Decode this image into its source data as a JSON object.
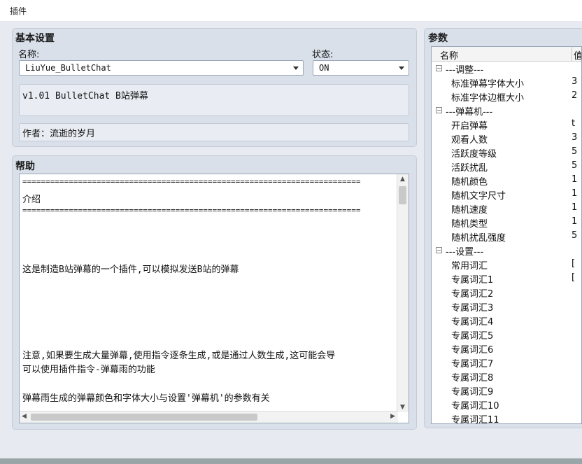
{
  "window": {
    "title": "插件"
  },
  "basic": {
    "title": "基本设置",
    "name_label": "名称:",
    "name_value": "LiuYue_BulletChat",
    "status_label": "状态:",
    "status_value": "ON",
    "description": "v1.01 BulletChat B站弹幕",
    "author": "作者：流逝的岁月"
  },
  "help": {
    "title": "帮助",
    "lines": [
      "=========================================================================",
      "介绍",
      "=========================================================================",
      "这是制造B站弹幕的一个插件,可以模拟发送B站的弹幕",
      "注意,如果要生成大量弹幕,使用指令逐条生成,或是通过人数生成,这可能会导",
      "可以使用插件指令-弹幕雨的功能",
      "弹幕雨生成的弹幕颜色和字体大小与设置'弹幕机'的参数有关"
    ]
  },
  "params": {
    "title": "参数",
    "col_name": "名称",
    "col_value": "值",
    "rows": [
      {
        "type": "group",
        "label": "---调整---",
        "value": ""
      },
      {
        "type": "item",
        "label": "标准弹幕字体大小",
        "value": "3"
      },
      {
        "type": "item",
        "label": "标准字体边框大小",
        "value": "2"
      },
      {
        "type": "group",
        "label": "---弹幕机---",
        "value": ""
      },
      {
        "type": "item",
        "label": "开启弹幕",
        "value": "t"
      },
      {
        "type": "item",
        "label": "观看人数",
        "value": "3"
      },
      {
        "type": "item",
        "label": "活跃度等级",
        "value": "5"
      },
      {
        "type": "item",
        "label": "活跃扰乱",
        "value": "5"
      },
      {
        "type": "item",
        "label": "随机颜色",
        "value": "1"
      },
      {
        "type": "item",
        "label": "随机文字尺寸",
        "value": "1"
      },
      {
        "type": "item",
        "label": "随机速度",
        "value": "1"
      },
      {
        "type": "item",
        "label": "随机类型",
        "value": "1"
      },
      {
        "type": "item",
        "label": "随机扰乱强度",
        "value": "5"
      },
      {
        "type": "group",
        "label": "---设置---",
        "value": ""
      },
      {
        "type": "item",
        "label": "常用词汇",
        "value": "["
      },
      {
        "type": "item",
        "label": "专属词汇1",
        "value": "["
      },
      {
        "type": "item",
        "label": "专属词汇2",
        "value": ""
      },
      {
        "type": "item",
        "label": "专属词汇3",
        "value": ""
      },
      {
        "type": "item",
        "label": "专属词汇4",
        "value": ""
      },
      {
        "type": "item",
        "label": "专属词汇5",
        "value": ""
      },
      {
        "type": "item",
        "label": "专属词汇6",
        "value": ""
      },
      {
        "type": "item",
        "label": "专属词汇7",
        "value": ""
      },
      {
        "type": "item",
        "label": "专属词汇8",
        "value": ""
      },
      {
        "type": "item",
        "label": "专属词汇9",
        "value": ""
      },
      {
        "type": "item",
        "label": "专属词汇10",
        "value": ""
      },
      {
        "type": "item",
        "label": "专属词汇11",
        "value": ""
      }
    ]
  }
}
